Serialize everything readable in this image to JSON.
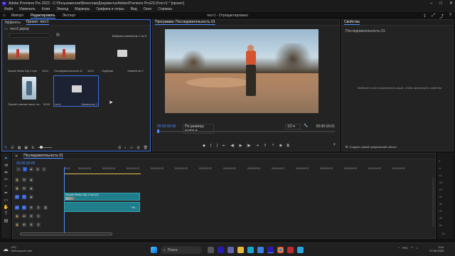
{
  "app": {
    "title": "Adobe Premiere Pro 2023 - C:\\Пользователи\\Вячеслав\\Документы\\Adobe\\Premiere Pro\\23.0\\тест1 * [проект]",
    "window_buttons": [
      "–",
      "□",
      "✕"
    ]
  },
  "menu": [
    "Файл",
    "Изменить",
    "Клип",
    "Эпизод",
    "Маркеры",
    "Графика и титры",
    "Вид",
    "Окно",
    "Справка"
  ],
  "workspace": {
    "tabs": [
      "Импорт",
      "Редактировать",
      "Экспорт"
    ],
    "active": "Редактировать",
    "center_title": "тест1 - Отредактировано"
  },
  "project": {
    "tabs": [
      "Эффекты",
      "Проект: тест1"
    ],
    "path": "тест1.prproj",
    "search_placeholder": "",
    "selected_count": "Выбрано элементов: 1 из 5",
    "items": [
      {
        "name": "Sample Media Clip 2.mp4",
        "duration": "16:01"
      },
      {
        "name": "Последовательность 01",
        "duration": "16:01"
      },
      {
        "name": "Подборки",
        "duration": "Элементов: 0"
      },
      {
        "name": "Перелёт сменяет меня тот...",
        "duration": "00:00"
      },
      {
        "name": "тест1",
        "duration": "Элементов: 0"
      }
    ]
  },
  "program": {
    "title": "Программа: Последовательность 01",
    "timecode_left": "00:00:00:00",
    "fit": "По размеру кадра",
    "quality": "1/2",
    "timecode_right": "00:00:16:01"
  },
  "properties": {
    "title": "Свойства",
    "subtitle": "Последовательность 01",
    "hint": "Выберите клип на временной шкале, чтобы просмотреть свойства",
    "new_graphic": "Создать новый графический объект"
  },
  "timeline": {
    "title": "Последовательность 01",
    "timecode": "00:00:00:00",
    "ruler": [
      "00:00",
      "00:00:04:23",
      "00:00:09:23",
      "00:00:14:23",
      "00:00:19:23",
      "00:00:24:23",
      "00:00:29:23",
      "00:00:34:23",
      "00:00:39:23",
      "00:00:44:22",
      "00:00:49:22",
      "00:00:54:22",
      "00:00:59:22",
      "00:01:04:22",
      "00:01:09:22"
    ],
    "video_tracks": [
      "V3",
      "V2",
      "V1"
    ],
    "audio_tracks": [
      "A1",
      "A2",
      "A3"
    ],
    "clip_video": "Sample Media Clip 2.mp4 [V]",
    "meter_labels": [
      "0",
      "-6",
      "-12",
      "-18",
      "-24",
      "-30",
      "-36",
      "-42",
      "-48",
      "-54"
    ],
    "meter_bottom": "S S"
  },
  "taskbar": {
    "weather_temp": "-0°C",
    "weather_text": "Небольшой снег",
    "search_placeholder": "Поиск",
    "lang": "РУС",
    "time": "3:14",
    "date": "27.06.2023"
  }
}
